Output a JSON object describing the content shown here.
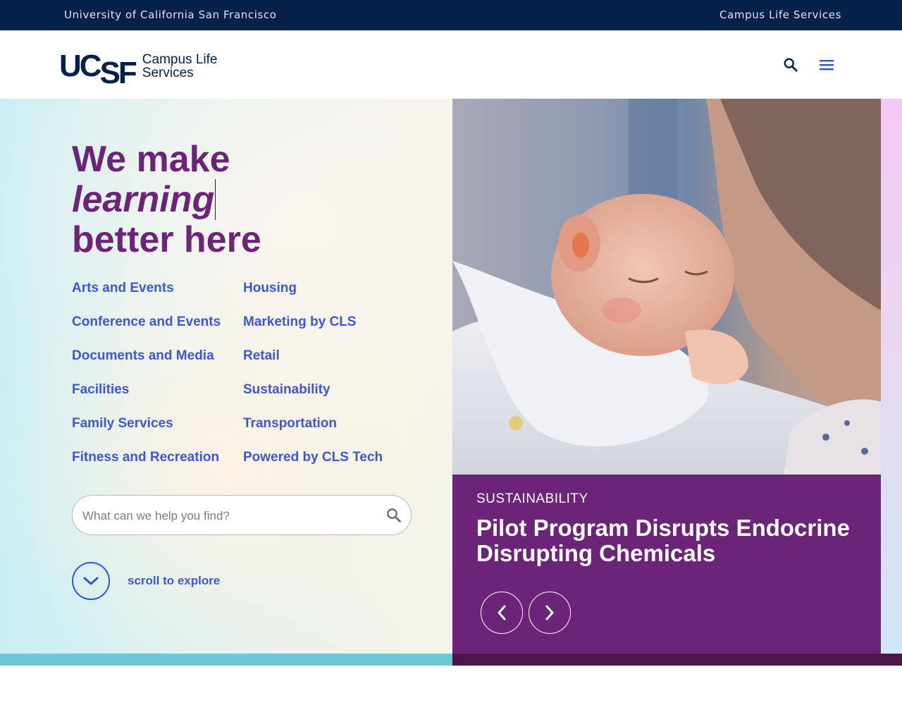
{
  "topbar": {
    "university": "University of California San Francisco",
    "site_link": "Campus Life Services"
  },
  "header": {
    "logo_mark": "UCSF",
    "logo_line1": "Campus Life",
    "logo_line2": "Services",
    "icons": [
      "search-icon",
      "menu-icon"
    ]
  },
  "hero": {
    "headline_line1": "We make",
    "headline_line2": "learning",
    "headline_line3": "better here",
    "links_col1": [
      "Arts and Events",
      "Conference and Events",
      "Documents and Media",
      "Facilities",
      "Family Services",
      "Fitness and Recreation"
    ],
    "links_col2": [
      "Housing",
      "Marketing by CLS",
      "Retail",
      "Sustainability",
      "Transportation",
      "Powered by CLS Tech"
    ],
    "search_placeholder": "What can we help you find?",
    "scroll_label": "scroll to explore"
  },
  "carousel": {
    "category": "SUSTAINABILITY",
    "title": "Pilot Program Disrupts Endocrine Disrupting Chemicals"
  },
  "colors": {
    "navy": "#052049",
    "purple": "#6c2479",
    "link_blue": "#3d57d6",
    "teal_band": "#6ac9d2",
    "dark_purple_band": "#4b1648"
  }
}
